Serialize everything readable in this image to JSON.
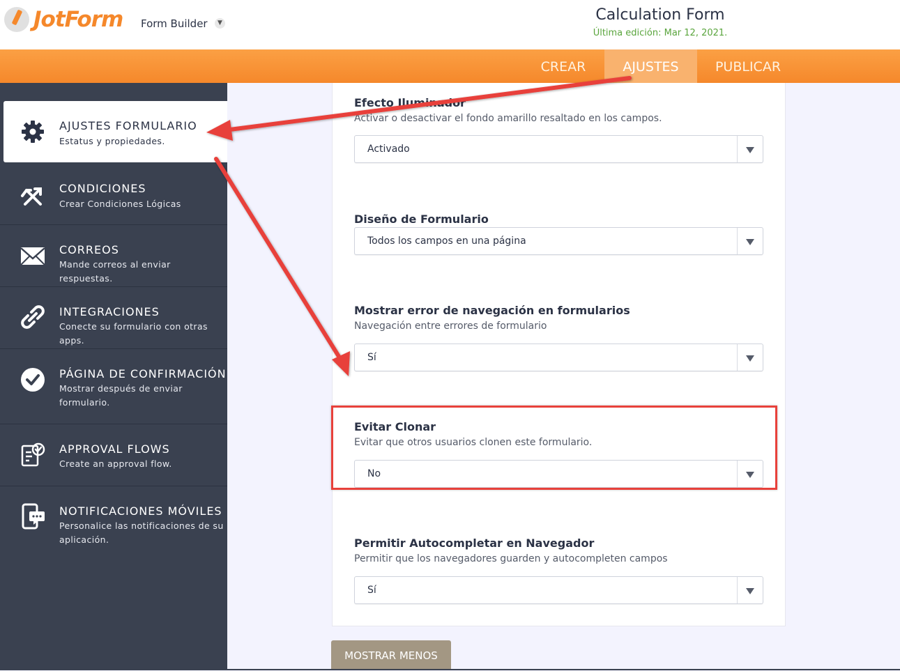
{
  "header": {
    "logo_text": "JotForm",
    "builder_label": "Form Builder",
    "form_title": "Calculation Form",
    "last_edit": "Última edición: Mar 12, 2021."
  },
  "nav": {
    "tabs": [
      {
        "label": "CREAR"
      },
      {
        "label": "AJUSTES"
      },
      {
        "label": "PUBLICAR"
      }
    ]
  },
  "sidebar": {
    "items": [
      {
        "title": "AJUSTES FORMULARIO",
        "desc": "Estatus y propiedades.",
        "icon": "gear-icon"
      },
      {
        "title": "CONDICIONES",
        "desc": "Crear Condiciones Lógicas",
        "icon": "conditions-icon"
      },
      {
        "title": "CORREOS",
        "desc": "Mande correos al enviar respuestas.",
        "icon": "envelope-icon"
      },
      {
        "title": "INTEGRACIONES",
        "desc": "Conecte su formulario con otras apps.",
        "icon": "link-icon"
      },
      {
        "title": "PÁGINA DE CONFIRMACIÓN",
        "desc": "Mostrar después de enviar formulario.",
        "icon": "check-circle-icon"
      },
      {
        "title": "APPROVAL FLOWS",
        "desc": "Create an approval flow.",
        "icon": "approval-icon"
      },
      {
        "title": "NOTIFICACIONES MÓVILES",
        "desc": "Personalice las notificaciones de su aplicación.",
        "icon": "mobile-chat-icon"
      }
    ]
  },
  "settings": [
    {
      "label": "Efecto Iluminador",
      "desc": "Activar o desactivar el fondo amarillo resaltado en los campos.",
      "value": "Activado"
    },
    {
      "label": "Diseño de Formulario",
      "desc": "",
      "value": "Todos los campos en una página"
    },
    {
      "label": "Mostrar error de navegación en formularios",
      "desc": "Navegación entre errores de formulario",
      "value": "Sí"
    },
    {
      "label": "Evitar Clonar",
      "desc": "Evitar que otros usuarios clonen este formulario.",
      "value": "No"
    },
    {
      "label": "Permitir Autocompletar en Navegador",
      "desc": "Permitir que los navegadores guarden y autocompleten campos",
      "value": "Sí"
    }
  ],
  "show_less_label": "MOSTRAR MENOS",
  "colors": {
    "brand_orange": "#f5882b",
    "sidebar_bg": "#3a4150",
    "annotation_red": "#e8413b",
    "button_tan": "#a39783"
  }
}
